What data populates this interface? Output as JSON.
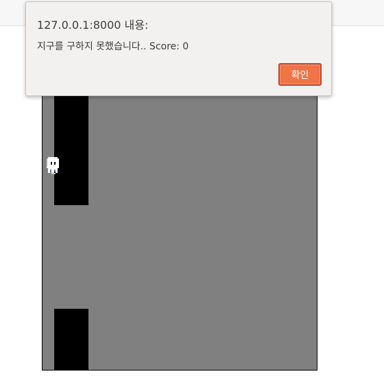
{
  "dialog": {
    "title": "127.0.0.1:8000 내용:",
    "message": "지구를 구하지 못했습니다.. Score: 0",
    "confirm_label": "확인"
  },
  "game": {
    "score": 0
  },
  "colors": {
    "game_background": "#808080",
    "pipe": "#000000",
    "confirm_button": "#ef7446",
    "dialog_background": "#f2f1f0"
  },
  "icons": {
    "player": "ghost-character-icon"
  }
}
